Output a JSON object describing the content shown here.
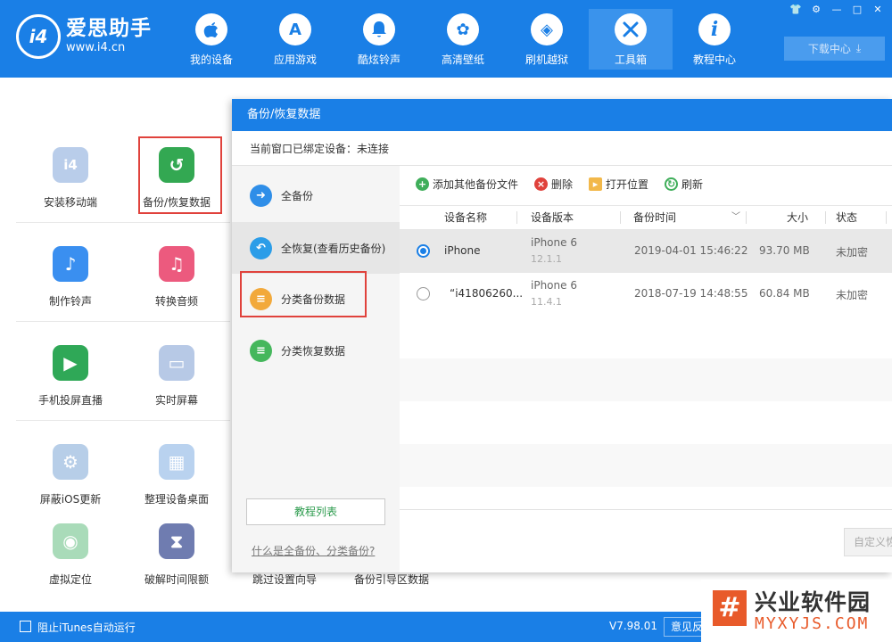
{
  "app": {
    "logo_mark": "i4",
    "name": "爱思助手",
    "url": "www.i4.cn"
  },
  "nav": [
    {
      "label": "我的设备",
      "icon": "apple-icon",
      "glyph": ""
    },
    {
      "label": "应用游戏",
      "icon": "appstore-icon",
      "glyph": "A"
    },
    {
      "label": "酷炫铃声",
      "icon": "bell-icon",
      "glyph": "♪"
    },
    {
      "label": "高清壁纸",
      "icon": "flower-icon",
      "glyph": "✿"
    },
    {
      "label": "刷机越狱",
      "icon": "box-icon",
      "glyph": "◈"
    },
    {
      "label": "工具箱",
      "icon": "tools-icon",
      "glyph": "✕",
      "active": true
    },
    {
      "label": "教程中心",
      "icon": "info-icon",
      "glyph": "i"
    }
  ],
  "window_controls": [
    "shirt-icon",
    "gear-icon",
    "minimize-icon",
    "maximize-icon",
    "close-icon"
  ],
  "download": {
    "label": "下载中心",
    "icon": "download-icon"
  },
  "tools": [
    {
      "label": "安装移动端",
      "icon": "i4-app-icon",
      "color": "#b9cdea",
      "glyph": "i4"
    },
    {
      "label": "备份/恢复数据",
      "icon": "backup-restore-icon",
      "color": "#33a852",
      "glyph": "↺"
    },
    {
      "label": "制作铃声",
      "icon": "bell-plus-icon",
      "color": "#3a8ff0",
      "glyph": "♪"
    },
    {
      "label": "转换音频",
      "icon": "music-icon",
      "color": "#ec5a7e",
      "glyph": "♫"
    },
    {
      "label": "手机投屏直播",
      "icon": "screen-cast-icon",
      "color": "#2fa857",
      "glyph": "▶"
    },
    {
      "label": "实时屏幕",
      "icon": "monitor-icon",
      "color": "#b7c9e6",
      "glyph": "▭"
    },
    {
      "label": "屏蔽iOS更新",
      "icon": "block-update-icon",
      "color": "#b7cee8",
      "glyph": "⚙"
    },
    {
      "label": "整理设备桌面",
      "icon": "grid-icon",
      "color": "#b9d2ef",
      "glyph": "▦"
    },
    {
      "label": "虚拟定位",
      "icon": "location-icon",
      "color": "#a9dbb9",
      "glyph": "◉"
    },
    {
      "label": "破解时间限额",
      "icon": "hourglass-icon",
      "color": "#6f7cb0",
      "glyph": "⧗"
    }
  ],
  "under_labels": [
    "跳过设置向导",
    "备份引导区数据"
  ],
  "dialog": {
    "title": "备份/恢复数据",
    "status": "当前窗口已绑定设备：未连接",
    "modes": [
      {
        "label": "全备份",
        "icon": "backup-arrow-icon",
        "color": "#2f8ee8",
        "glyph": "➜"
      },
      {
        "label": "全恢复(查看历史备份)",
        "icon": "restore-arrow-icon",
        "color": "#2b9de8",
        "glyph": "↶"
      },
      {
        "label": "分类备份数据",
        "icon": "category-backup-icon",
        "color": "#f2a93b",
        "glyph": "≡"
      },
      {
        "label": "分类恢复数据",
        "icon": "category-restore-icon",
        "color": "#45b75c",
        "glyph": "≡"
      }
    ],
    "tutorial_button": "教程列表",
    "help_link": "什么是全备份、分类备份?",
    "toolbar": {
      "add": "添加其他备份文件",
      "delete": "删除",
      "open": "打开位置",
      "refresh": "刷新"
    },
    "columns": [
      "设备名称",
      "设备版本",
      "备份时间",
      "大小",
      "状态"
    ],
    "rows": [
      {
        "name": "iPhone",
        "model": "iPhone 6",
        "ios": "12.1.1",
        "time": "2019-04-01 15:46:22",
        "size": "93.70 MB",
        "status": "未加密",
        "selected": true
      },
      {
        "name": "“i41806260...",
        "model": "iPhone 6",
        "ios": "11.4.1",
        "time": "2018-07-19 14:48:55",
        "size": "60.84 MB",
        "status": "未加密",
        "selected": false
      }
    ],
    "custom_button": "自定义恢"
  },
  "statusbar": {
    "checkbox_label": "阻止iTunes自动运行",
    "version": "V7.98.01",
    "feedback": "意见反馈"
  },
  "watermark": {
    "mark": "#",
    "title": "兴业软件园",
    "sub": "MYXYJS.COM"
  },
  "highlight_color": "#e0423c"
}
